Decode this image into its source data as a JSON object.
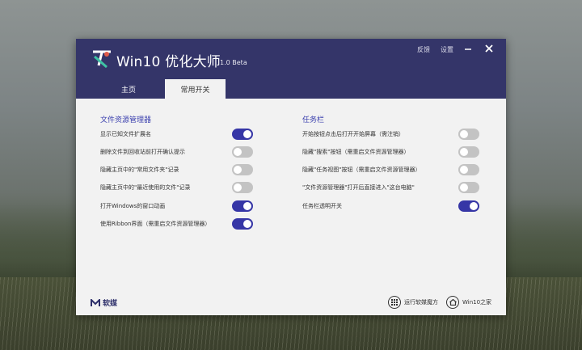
{
  "titlebar": {
    "title": "Win10 优化大师",
    "version": "1.0 Beta",
    "links": {
      "feedback": "反馈",
      "settings": "设置"
    },
    "buttons": {
      "minimize": "minimize-icon",
      "close": "close-icon"
    },
    "background_color": "#343569"
  },
  "tabs": [
    {
      "label": "主页",
      "active": false
    },
    {
      "label": "常用开关",
      "active": true
    }
  ],
  "file_explorer": {
    "title": "文件资源管理器",
    "items": [
      {
        "label": "显示已知文件扩展名",
        "on": true
      },
      {
        "label": "删除文件到回收站前打开确认提示",
        "on": false
      },
      {
        "label": "隐藏主页中的\"常用文件夹\"记录",
        "on": false
      },
      {
        "label": "隐藏主页中的\"最近使用的文件\"记录",
        "on": false
      },
      {
        "label": "打开Windows的窗口动画",
        "on": true
      },
      {
        "label": "使用Ribbon界面（需重启文件资源管理器）",
        "on": true
      }
    ]
  },
  "taskbar": {
    "title": "任务栏",
    "items": [
      {
        "label": "开始按钮点击后打开开始屏幕（需注销）",
        "on": false
      },
      {
        "label": "隐藏\"搜索\"按钮（需重启文件资源管理器）",
        "on": false
      },
      {
        "label": "隐藏\"任务视图\"按钮（需重启文件资源管理器）",
        "on": false
      },
      {
        "label": "\"文件资源管理器\"打开后直接进入\"这台电脑\"",
        "on": false
      },
      {
        "label": "任务栏透明开关",
        "on": true
      }
    ]
  },
  "footer": {
    "brand": "软媒",
    "run_magic_cube": "运行软媒魔方",
    "win10_home": "Win10之家"
  },
  "colors": {
    "accent": "#3636a6",
    "toggle_off": "#c3c3c3",
    "section_title": "#3a3fae"
  }
}
